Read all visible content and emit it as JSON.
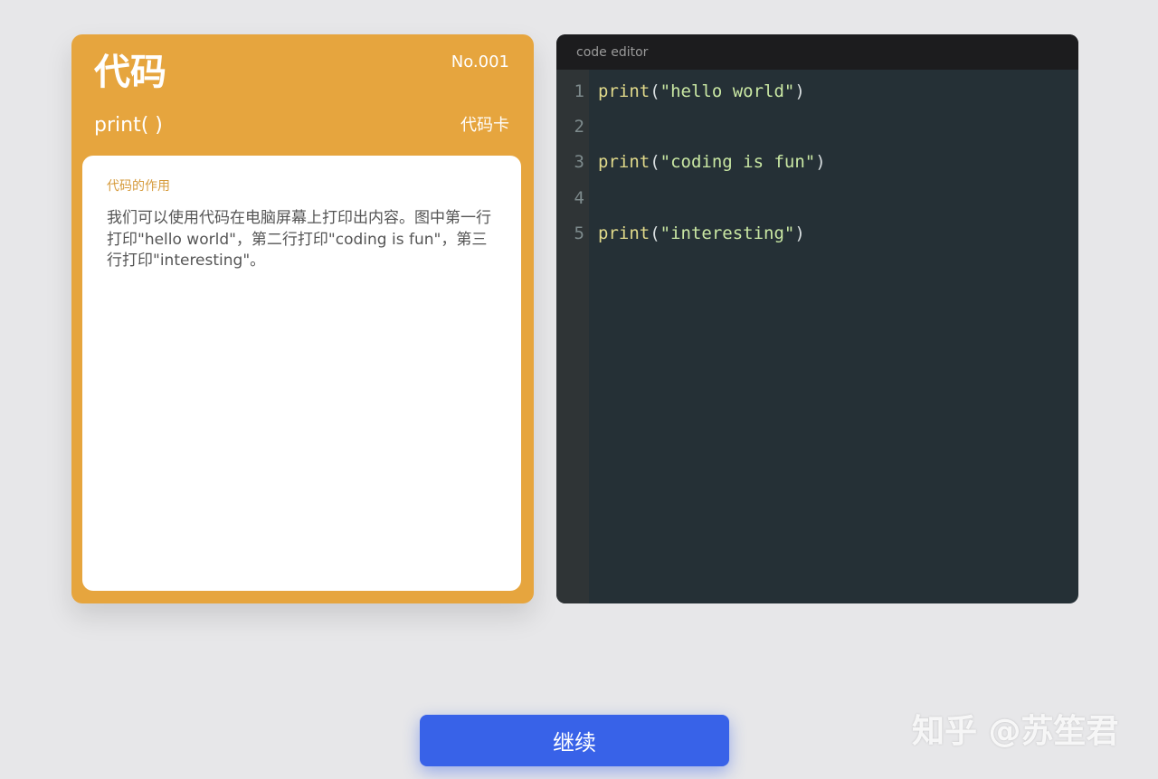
{
  "card": {
    "title": "代码",
    "number": "No.001",
    "function": "print( )",
    "type_label": "代码卡",
    "body_heading": "代码的作用",
    "body_text": "我们可以使用代码在电脑屏幕上打印出内容。图中第一行打印\"hello world\"，第二行打印\"coding is fun\"，第三行打印\"interesting\"。"
  },
  "editor": {
    "title": "code editor",
    "lines": [
      {
        "num": "1",
        "keyword": "print",
        "open": "(",
        "string": "\"hello world\"",
        "close": ")"
      },
      {
        "num": "2",
        "keyword": "",
        "open": "",
        "string": "",
        "close": ""
      },
      {
        "num": "3",
        "keyword": "print",
        "open": "(",
        "string": "\"coding is fun\"",
        "close": ")"
      },
      {
        "num": "4",
        "keyword": "",
        "open": "",
        "string": "",
        "close": ""
      },
      {
        "num": "5",
        "keyword": "print",
        "open": "(",
        "string": "\"interesting\"",
        "close": ")"
      }
    ]
  },
  "button": {
    "continue_label": "继续"
  },
  "watermark": {
    "text": "知乎 @苏笙君"
  },
  "colors": {
    "card_accent": "#e6a53e",
    "button_blue": "#3862e8",
    "editor_bg": "#253036"
  }
}
